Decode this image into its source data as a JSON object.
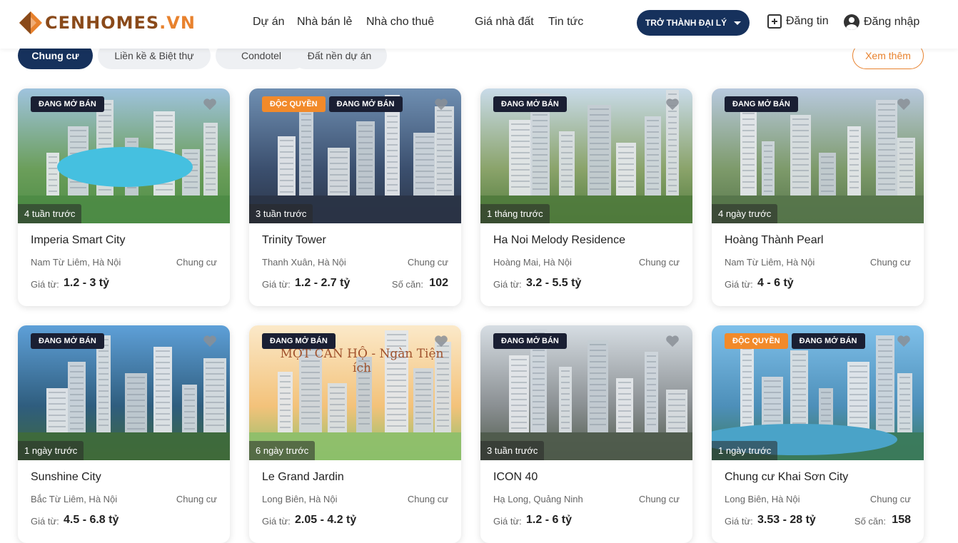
{
  "brand": {
    "logo_main": "CENHOMES",
    "logo_suffix": ".VN",
    "colors": {
      "navy": "#16315c",
      "orange": "#e8822e",
      "brown": "#8a4a1a"
    }
  },
  "nav": {
    "items": [
      "Dự án",
      "Nhà bán lẻ",
      "Nhà cho thuê",
      "Giá nhà đất",
      "Tin tức"
    ]
  },
  "header": {
    "agent_button": "TRỞ THÀNH ĐẠI LÝ",
    "post_label": "Đăng tin",
    "login_label": "Đăng nhập",
    "post_icon": "plus-box-icon",
    "login_icon": "account-circle-icon"
  },
  "tabs": {
    "items": [
      "Chung cư",
      "Liền kề & Biệt thự",
      "Condotel",
      "Đất nền dự án"
    ],
    "active": "Chung cư",
    "more_label": "Xem thêm"
  },
  "labels": {
    "price_from": "Giá từ:",
    "unit_count": "Số căn:"
  },
  "cards": [
    {
      "title": "Imperia Smart City",
      "location": "Nam Từ Liêm, Hà Nội",
      "type": "Chung cư",
      "price": "1.2 - 3 tỷ",
      "units": "",
      "time": "4 tuần trước",
      "badges": [
        "ĐANG MỞ BÁN"
      ],
      "exclusive": ""
    },
    {
      "title": "Trinity Tower",
      "location": "Thanh Xuân, Hà Nội",
      "type": "Chung cư",
      "price": "1.2 - 2.7 tỷ",
      "units": "102",
      "time": "3 tuần trước",
      "badges": [
        "ĐANG MỞ BÁN"
      ],
      "exclusive": "ĐỘC QUYỀN"
    },
    {
      "title": "Ha Noi Melody Residence",
      "location": "Hoàng Mai, Hà Nội",
      "type": "Chung cư",
      "price": "3.2 - 5.5 tỷ",
      "units": "",
      "time": "1 tháng trước",
      "badges": [
        "ĐANG MỞ BÁN"
      ],
      "exclusive": ""
    },
    {
      "title": "Hoàng Thành Pearl",
      "location": "Nam Từ Liêm, Hà Nội",
      "type": "Chung cư",
      "price": "4 - 6 tỷ",
      "units": "",
      "time": "4 ngày trước",
      "badges": [
        "ĐANG MỞ BÁN"
      ],
      "exclusive": ""
    },
    {
      "title": "Sunshine City",
      "location": "Bắc Từ Liêm, Hà Nội",
      "type": "Chung cư",
      "price": "4.5 - 6.8 tỷ",
      "units": "",
      "time": "1 ngày trước",
      "badges": [
        "ĐANG MỞ BÁN"
      ],
      "exclusive": ""
    },
    {
      "title": "Le Grand Jardin",
      "location": "Long Biên, Hà Nội",
      "type": "Chung cư",
      "price": "2.05 - 4.2 tỷ",
      "units": "",
      "time": "6 ngày trước",
      "badges": [
        "ĐANG MỞ BÁN"
      ],
      "exclusive": "",
      "image_text": "MỘT CĂN HỘ - Ngàn Tiện ích"
    },
    {
      "title": "ICON 40",
      "location": "Hạ Long, Quảng Ninh",
      "type": "Chung cư",
      "price": "1.2 - 6 tỷ",
      "units": "",
      "time": "3 tuần trước",
      "badges": [
        "ĐANG MỞ BÁN"
      ],
      "exclusive": ""
    },
    {
      "title": "Chung cư Khai Sơn City",
      "location": "Long Biên, Hà Nội",
      "type": "Chung cư",
      "price": "3.53 - 28 tỷ",
      "units": "158",
      "time": "1 ngày trước",
      "badges": [
        "ĐANG MỞ BÁN"
      ],
      "exclusive": "ĐỘC QUYỀN"
    }
  ]
}
